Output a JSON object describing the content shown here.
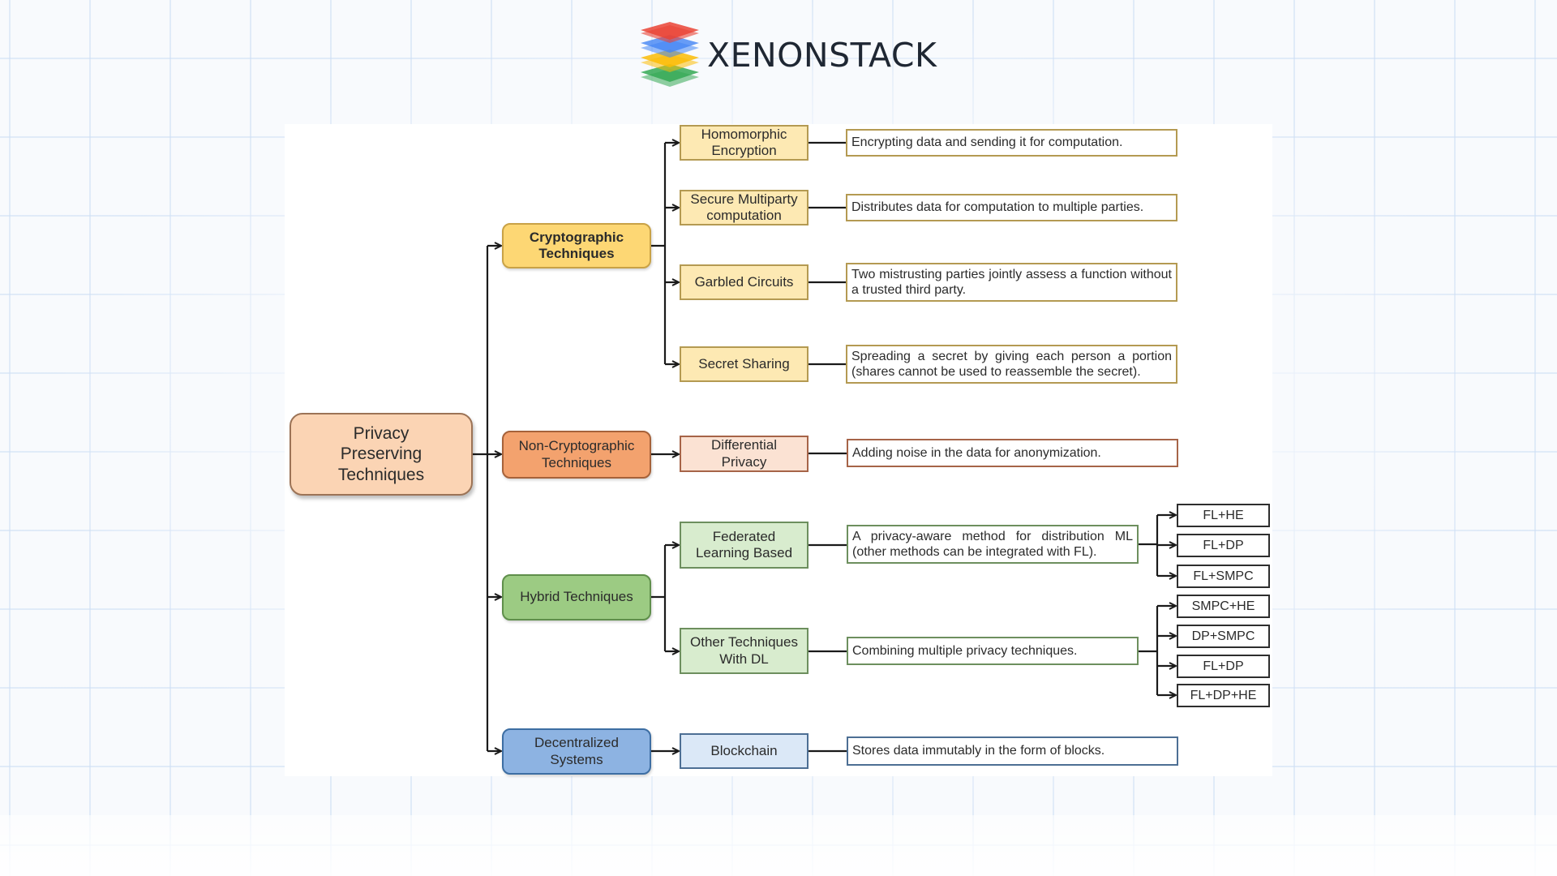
{
  "brand": {
    "name": "XENONSTACK",
    "logo_icon": "stacked-layers-icon",
    "logo_colors": [
      "#ea4335",
      "#4285f4",
      "#fbbc05",
      "#34a853"
    ]
  },
  "diagram": {
    "root": {
      "label": "Privacy Preserving Techniques",
      "color": "#fbd4b4"
    },
    "categories": [
      {
        "label": "Cryptographic Techniques",
        "color": "#fdd774",
        "techniques": [
          {
            "label": "Homomorphic Encryption",
            "description": "Encrypting data and sending it for computation."
          },
          {
            "label": "Secure Multiparty computation",
            "description": "Distributes data for computation to multiple parties."
          },
          {
            "label": "Garbled Circuits",
            "description": "Two mistrusting parties jointly assess a function without a trusted third party."
          },
          {
            "label": "Secret Sharing",
            "description": "Spreading a secret by giving each person a portion (shares cannot be used to reassemble the secret)."
          }
        ]
      },
      {
        "label": "Non-Cryptographic Techniques",
        "color": "#f3a26e",
        "techniques": [
          {
            "label": "Differential Privacy",
            "description": "Adding noise in the data for anonymization."
          }
        ]
      },
      {
        "label": "Hybrid Techniques",
        "color": "#9ccb83",
        "techniques": [
          {
            "label": "Federated Learning Based",
            "description": "A privacy-aware method for distribution ML (other methods can be integrated with FL).",
            "combinations": [
              "FL+HE",
              "FL+DP",
              "FL+SMPC"
            ]
          },
          {
            "label": "Other Techniques With DL",
            "description": "Combining multiple privacy techniques.",
            "combinations": [
              "SMPC+HE",
              "DP+SMPC",
              "FL+DP",
              "FL+DP+HE"
            ]
          }
        ]
      },
      {
        "label": "Decentralized Systems",
        "color": "#8db3e2",
        "techniques": [
          {
            "label": "Blockchain",
            "description": "Stores data immutably in the form of blocks."
          }
        ]
      }
    ]
  }
}
